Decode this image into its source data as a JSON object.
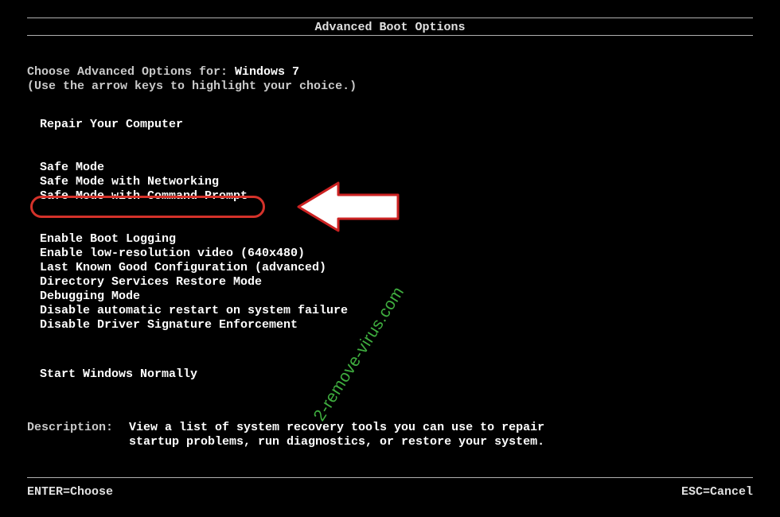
{
  "title": "Advanced Boot Options",
  "prompt_label": "Choose Advanced Options for: ",
  "os_name": "Windows 7",
  "instruction": "(Use the arrow keys to highlight your choice.)",
  "menu": {
    "repair": "Repair Your Computer",
    "group1": [
      "Safe Mode",
      "Safe Mode with Networking",
      "Safe Mode with Command Prompt"
    ],
    "group2": [
      "Enable Boot Logging",
      "Enable low-resolution video (640x480)",
      "Last Known Good Configuration (advanced)",
      "Directory Services Restore Mode",
      "Debugging Mode",
      "Disable automatic restart on system failure",
      "Disable Driver Signature Enforcement"
    ],
    "start_normal": "Start Windows Normally"
  },
  "highlighted_index": 2,
  "description": {
    "label": "Description:",
    "text": "View a list of system recovery tools you can use to repair startup problems, run diagnostics, or restore your system."
  },
  "footer": {
    "enter": "ENTER=Choose",
    "esc": "ESC=Cancel"
  },
  "watermark": "2-remove-virus.com",
  "colors": {
    "highlight_ring": "#d4322a",
    "text": "#d6d6d6",
    "bright": "#ffffff",
    "watermark": "#3fae3f"
  }
}
